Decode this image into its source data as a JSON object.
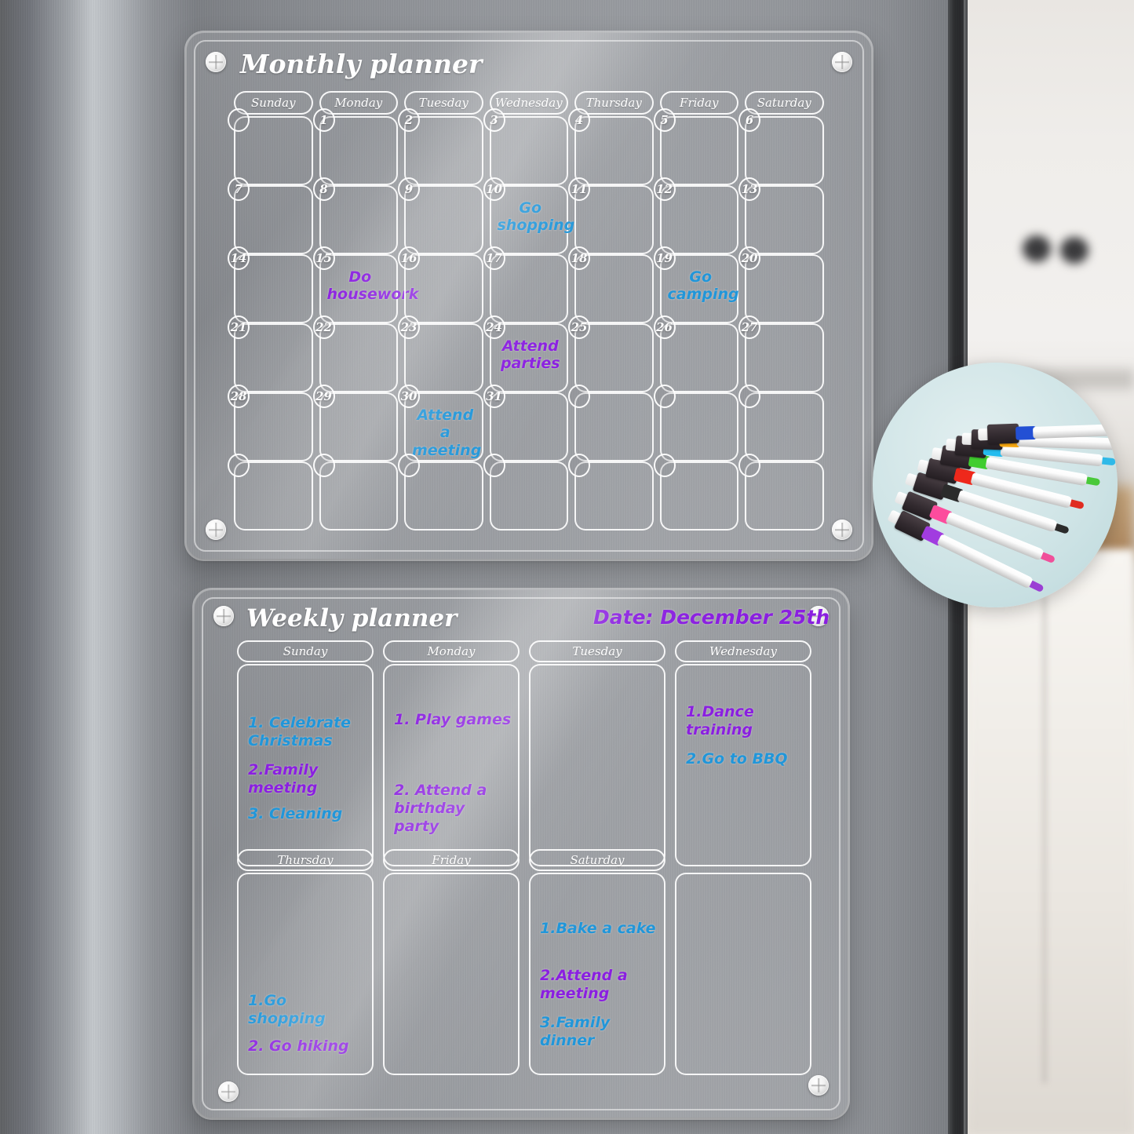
{
  "monthly": {
    "title": "Monthly planner",
    "day_headers": [
      "Sunday",
      "Monday",
      "Tuesday",
      "Wednesday",
      "Thursday",
      "Friday",
      "Saturday"
    ],
    "weeks": [
      [
        {
          "num": "",
          "note": "",
          "ink": ""
        },
        {
          "num": "1",
          "note": "",
          "ink": ""
        },
        {
          "num": "2",
          "note": "",
          "ink": ""
        },
        {
          "num": "3",
          "note": "",
          "ink": ""
        },
        {
          "num": "4",
          "note": "",
          "ink": ""
        },
        {
          "num": "5",
          "note": "",
          "ink": ""
        },
        {
          "num": "6",
          "note": "",
          "ink": ""
        }
      ],
      [
        {
          "num": "7",
          "note": "",
          "ink": ""
        },
        {
          "num": "8",
          "note": "",
          "ink": ""
        },
        {
          "num": "9",
          "note": "",
          "ink": ""
        },
        {
          "num": "10",
          "note": "Go\nshopping",
          "ink": "blue"
        },
        {
          "num": "11",
          "note": "",
          "ink": ""
        },
        {
          "num": "12",
          "note": "",
          "ink": ""
        },
        {
          "num": "13",
          "note": "",
          "ink": ""
        }
      ],
      [
        {
          "num": "14",
          "note": "",
          "ink": ""
        },
        {
          "num": "15",
          "note": "Do\nhousework",
          "ink": "purple"
        },
        {
          "num": "16",
          "note": "",
          "ink": ""
        },
        {
          "num": "17",
          "note": "",
          "ink": ""
        },
        {
          "num": "18",
          "note": "",
          "ink": ""
        },
        {
          "num": "19",
          "note": "Go\ncamping",
          "ink": "blue"
        },
        {
          "num": "20",
          "note": "",
          "ink": ""
        }
      ],
      [
        {
          "num": "21",
          "note": "",
          "ink": ""
        },
        {
          "num": "22",
          "note": "",
          "ink": ""
        },
        {
          "num": "23",
          "note": "",
          "ink": ""
        },
        {
          "num": "24",
          "note": "Attend\nparties",
          "ink": "purple"
        },
        {
          "num": "25",
          "note": "",
          "ink": ""
        },
        {
          "num": "26",
          "note": "",
          "ink": ""
        },
        {
          "num": "27",
          "note": "",
          "ink": ""
        }
      ],
      [
        {
          "num": "28",
          "note": "",
          "ink": ""
        },
        {
          "num": "29",
          "note": "",
          "ink": ""
        },
        {
          "num": "30",
          "note": "Attend\na meeting",
          "ink": "blue"
        },
        {
          "num": "31",
          "note": "",
          "ink": ""
        },
        {
          "num": "",
          "note": "",
          "ink": ""
        },
        {
          "num": "",
          "note": "",
          "ink": ""
        },
        {
          "num": "",
          "note": "",
          "ink": ""
        }
      ],
      [
        {
          "num": "",
          "note": "",
          "ink": ""
        },
        {
          "num": "",
          "note": "",
          "ink": ""
        },
        {
          "num": "",
          "note": "",
          "ink": ""
        },
        {
          "num": "",
          "note": "",
          "ink": ""
        },
        {
          "num": "",
          "note": "",
          "ink": ""
        },
        {
          "num": "",
          "note": "",
          "ink": ""
        },
        {
          "num": "",
          "note": "",
          "ink": ""
        }
      ]
    ]
  },
  "weekly": {
    "title": "Weekly planner",
    "date_label": "Date: December 25th",
    "days": [
      {
        "name": "Sunday",
        "tasks": [
          {
            "text": "1. Celebrate\n    Christmas",
            "ink": "blue"
          },
          {
            "text": "2.Family meeting",
            "ink": "purple"
          },
          {
            "text": "3. Cleaning",
            "ink": "blue"
          }
        ]
      },
      {
        "name": "Monday",
        "tasks": [
          {
            "text": "1. Play games",
            "ink": "purple"
          },
          {
            "text": "2. Attend a\n    birthday party",
            "ink": "purple"
          }
        ]
      },
      {
        "name": "Tuesday",
        "tasks": []
      },
      {
        "name": "Wednesday",
        "tasks": [
          {
            "text": "1.Dance training",
            "ink": "purple"
          },
          {
            "text": "2.Go to BBQ",
            "ink": "blue"
          }
        ]
      },
      {
        "name": "Thursday",
        "tasks": [
          {
            "text": "1.Go shopping",
            "ink": "blue"
          },
          {
            "text": "2. Go hiking",
            "ink": "purple"
          }
        ]
      },
      {
        "name": "Friday",
        "tasks": []
      },
      {
        "name": "Saturday",
        "tasks": [
          {
            "text": "1.Bake a cake",
            "ink": "blue"
          },
          {
            "text": "2.Attend a meeting",
            "ink": "purple"
          },
          {
            "text": "3.Family dinner",
            "ink": "blue"
          }
        ]
      },
      {
        "name": "",
        "tasks": []
      }
    ]
  },
  "pens": {
    "count": 8,
    "colors": [
      "#9b3fd4",
      "#f0509a",
      "#2b2b2b",
      "#e02c20",
      "#49c93a",
      "#2fb9e8",
      "#f0a81e",
      "#2750c8"
    ]
  },
  "colors": {
    "ink_blue": "#2196d9",
    "ink_purple": "#8a1fe0",
    "engraved_white": "#ffffff",
    "board_tint": "rgba(255,255,255,0.10)"
  }
}
